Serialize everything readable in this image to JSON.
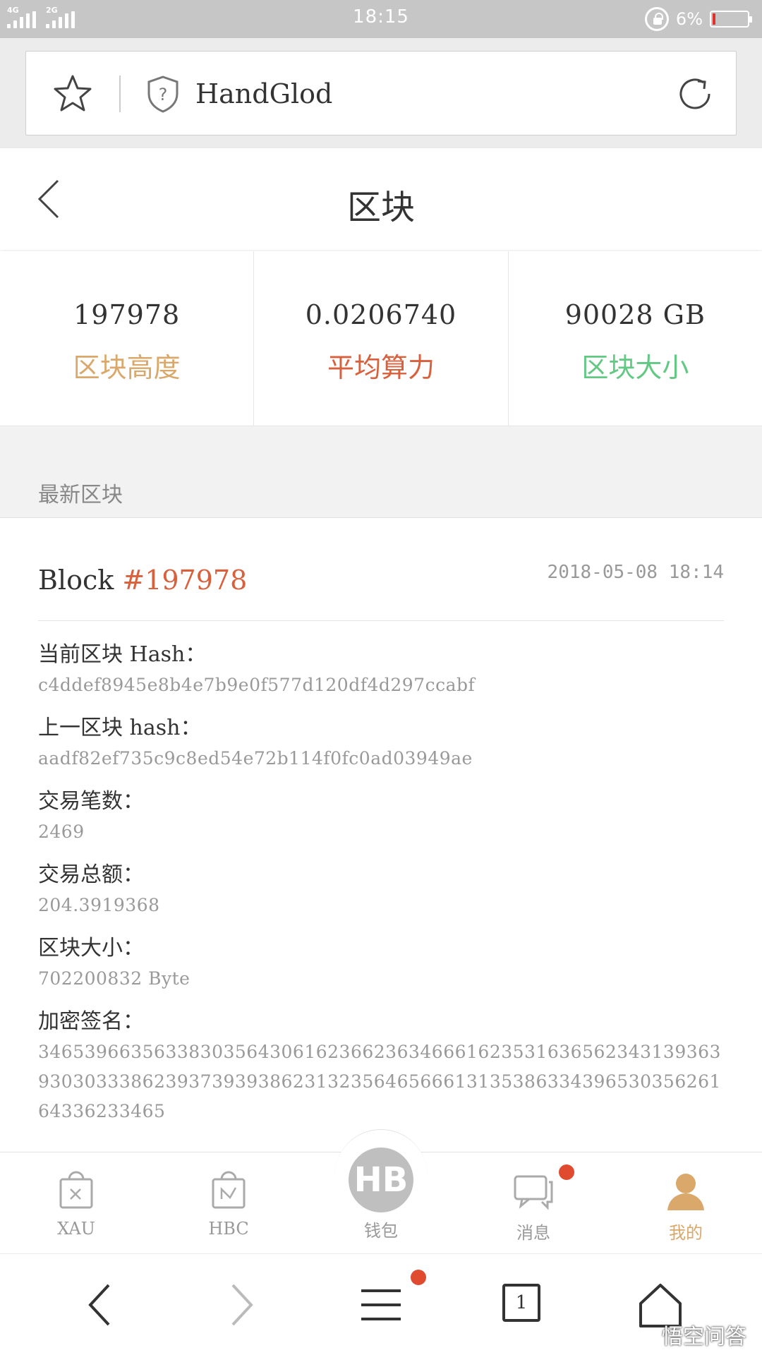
{
  "status": {
    "signal1": "4G",
    "signal2": "2G",
    "time": "18:15",
    "battery_pct": "6%"
  },
  "browser": {
    "url_text": "HandGlod"
  },
  "header": {
    "title": "区块"
  },
  "stats": [
    {
      "value": "197978",
      "label": "区块高度",
      "color": "#d9a86a"
    },
    {
      "value": "0.0206740",
      "label": "平均算力",
      "color": "#d8603c"
    },
    {
      "value": "90028 GB",
      "label": "区块大小",
      "color": "#62c883"
    }
  ],
  "section": {
    "title": "最新区块"
  },
  "block": {
    "prefix": "Block",
    "number": "#197978",
    "time": "2018-05-08 18:14",
    "fields": [
      {
        "label": "当前区块 Hash：",
        "value": "c4ddef8945e8b4e7b9e0f577d120df4d297ccabf"
      },
      {
        "label": "上一区块 hash：",
        "value": "aadf82ef735c9c8ed54e72b114f0fc0ad03949ae"
      },
      {
        "label": "交易笔数：",
        "value": "2469"
      },
      {
        "label": "交易总额：",
        "value": "204.3919368"
      },
      {
        "label": "区块大小：",
        "value": "702200832 Byte"
      },
      {
        "label": "加密签名：",
        "value": "346539663563383035643061623662363466616235316365623431393639303033386239373939386231323564656661313538633439653035626164336233465"
      }
    ]
  },
  "tabs": [
    {
      "label": "XAU",
      "icon": "xau-bag-icon"
    },
    {
      "label": "HBC",
      "icon": "hbc-bag-icon"
    },
    {
      "label": "钱包",
      "icon": "wallet-logo-icon",
      "logo": "HB"
    },
    {
      "label": "消息",
      "icon": "message-icon"
    },
    {
      "label": "我的",
      "icon": "profile-icon"
    }
  ],
  "browser_nav": {
    "tab_count": "1"
  },
  "watermark": "悟空问答",
  "colors": {
    "accent_gold": "#d9a86a",
    "accent_red": "#d8603c",
    "accent_green": "#62c883",
    "badge_red": "#e04a2f"
  }
}
